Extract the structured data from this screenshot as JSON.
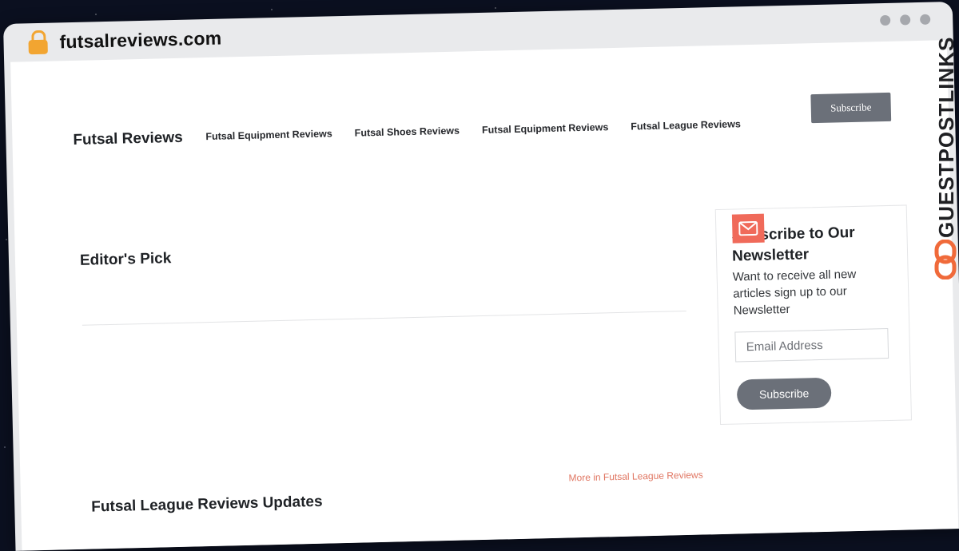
{
  "browser": {
    "domain": "futsalreviews.com",
    "icons": [
      "lock-icon"
    ]
  },
  "site": {
    "title": "Futsal Reviews",
    "nav": [
      "Futsal Equipment Reviews",
      "Futsal Shoes Reviews",
      "Futsal Equipment Reviews",
      "Futsal League Reviews"
    ],
    "subscribe_label": "Subscribe"
  },
  "main": {
    "editors_pick": "Editor's Pick",
    "updates_title": "Futsal League Reviews Updates",
    "more_link": "More in Futsal League Reviews"
  },
  "newsletter": {
    "title": "Subscribe to Our Newsletter",
    "description": "Want to receive all new articles sign up to our Newsletter",
    "email_placeholder": "Email Address",
    "button_label": "Subscribe",
    "icon": "mail-icon"
  },
  "watermark": {
    "text": "GUESTPOSTLINKS"
  },
  "colors": {
    "accent": "#f06a5a",
    "button": "#6b7079",
    "link": "#e07662"
  }
}
